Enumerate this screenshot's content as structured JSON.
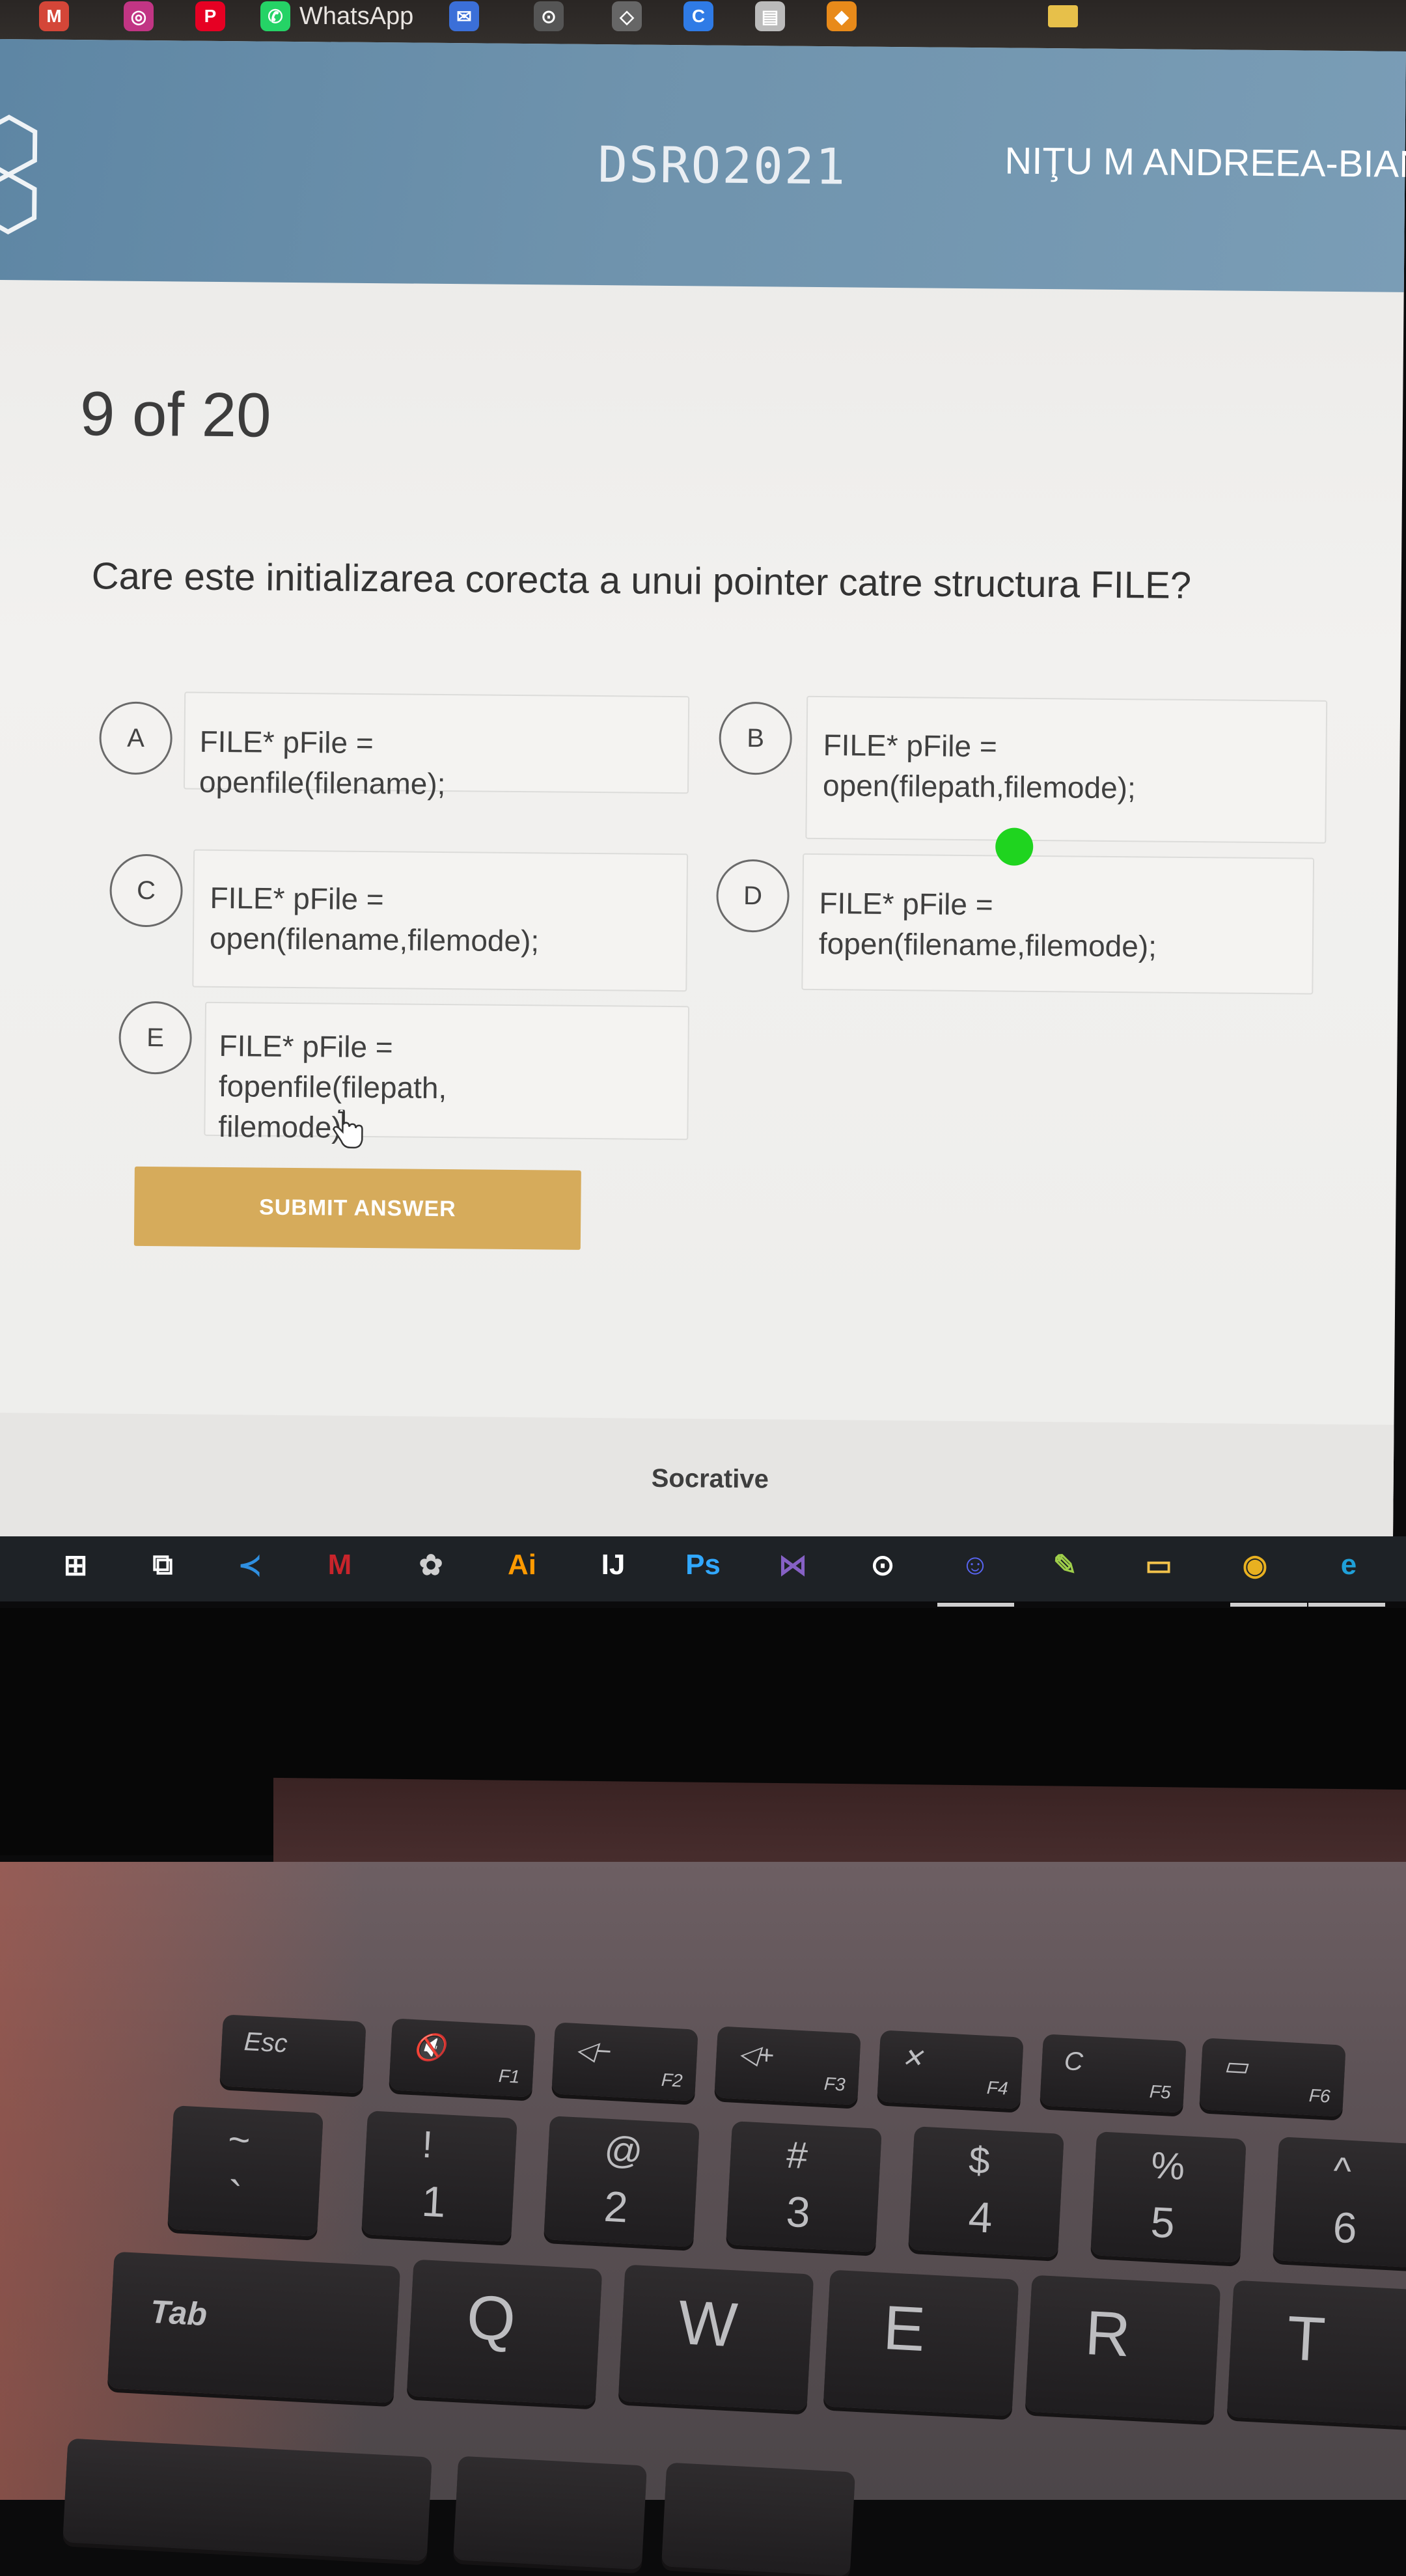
{
  "bookmarks": [
    {
      "icon": "gmail-icon",
      "label": "M",
      "color": "#d44638"
    },
    {
      "icon": "instagram-icon",
      "label": "◎",
      "color": "#c13584"
    },
    {
      "icon": "pinterest-icon",
      "label": "P",
      "color": "#e60023"
    },
    {
      "icon": "whatsapp-icon",
      "label": "✆",
      "color": "#25d366",
      "text": "WhatsApp"
    },
    {
      "icon": "mail-icon",
      "label": "✉",
      "color": "#3b6fd8"
    },
    {
      "icon": "github-icon",
      "label": "⊙",
      "color": "#555555"
    },
    {
      "icon": "codepen-icon",
      "label": "◇",
      "color": "#666666"
    },
    {
      "icon": "bookmark-c-icon",
      "label": "C",
      "color": "#2f7be6"
    },
    {
      "icon": "doc-icon",
      "label": "▤",
      "color": "#bbbbbb"
    },
    {
      "icon": "orange-icon",
      "label": "◆",
      "color": "#e88a1a"
    }
  ],
  "header": {
    "room_name": "DSRO2021",
    "student_name": "NIŢU M ANDREEA-BIAN"
  },
  "quiz": {
    "progress": "9 of 20",
    "question": "Care este initializarea corecta a unui pointer catre structura FILE?",
    "choices": [
      {
        "letter": "A",
        "line1": "FILE* pFile = openfile(filename);",
        "line2": ""
      },
      {
        "letter": "B",
        "line1": "FILE* pFile =",
        "line2": "open(filepath,filemode);"
      },
      {
        "letter": "C",
        "line1": "FILE* pFile =",
        "line2": "open(filename,filemode);"
      },
      {
        "letter": "D",
        "line1": "FILE* pFile =",
        "line2": "fopen(filename,filemode);"
      },
      {
        "letter": "E",
        "line1": "FILE* pFile = fopenfile(filepath,",
        "line2": "filemode);"
      }
    ],
    "submit_label": "SUBMIT ANSWER"
  },
  "footer": {
    "brand": "Socrative"
  },
  "taskbar": [
    {
      "icon": "windows-start-icon",
      "label": "⊞",
      "color": "#ffffff"
    },
    {
      "icon": "task-view-icon",
      "label": "⧉",
      "color": "#ffffff"
    },
    {
      "icon": "vscode-icon",
      "label": "≺",
      "color": "#2f8fe0"
    },
    {
      "icon": "mendeley-icon",
      "label": "M",
      "color": "#c8242b"
    },
    {
      "icon": "octave-icon",
      "label": "✿",
      "color": "#cfcfcf"
    },
    {
      "icon": "illustrator-icon",
      "label": "Ai",
      "color": "#ff9a00"
    },
    {
      "icon": "intellij-icon",
      "label": "IJ",
      "color": "#ffffff"
    },
    {
      "icon": "photoshop-icon",
      "label": "Ps",
      "color": "#31a8ff"
    },
    {
      "icon": "visual-studio-icon",
      "label": "⋈",
      "color": "#8661c5"
    },
    {
      "icon": "github-desktop-icon",
      "label": "⊙",
      "color": "#ffffff"
    },
    {
      "icon": "discord-icon",
      "label": "☺",
      "color": "#5865f2"
    },
    {
      "icon": "notepad-icon",
      "label": "✎",
      "color": "#9fcf4a"
    },
    {
      "icon": "file-explorer-icon",
      "label": "▭",
      "color": "#f2c24b"
    },
    {
      "icon": "chrome-icon",
      "label": "◉",
      "color": "#e8b020"
    },
    {
      "icon": "edge-icon",
      "label": "e",
      "color": "#1fa0d8"
    }
  ],
  "keyboard": {
    "function_row": [
      {
        "main": "Esc",
        "sub": ""
      },
      {
        "main": "🔇",
        "sub": "F1"
      },
      {
        "main": "◁−",
        "sub": "F2"
      },
      {
        "main": "◁+",
        "sub": "F3"
      },
      {
        "main": "✕",
        "sub": "F4"
      },
      {
        "main": "C",
        "sub": "F5"
      },
      {
        "main": "▭",
        "sub": "F6"
      }
    ],
    "number_row": [
      {
        "top": "~",
        "bottom": "`"
      },
      {
        "top": "!",
        "bottom": "1"
      },
      {
        "top": "@",
        "bottom": "2"
      },
      {
        "top": "#",
        "bottom": "3"
      },
      {
        "top": "$",
        "bottom": "4"
      },
      {
        "top": "%",
        "bottom": "5"
      },
      {
        "top": "^",
        "bottom": "6"
      }
    ],
    "letter_row": [
      "Tab",
      "Q",
      "W",
      "E",
      "R",
      "T"
    ]
  }
}
